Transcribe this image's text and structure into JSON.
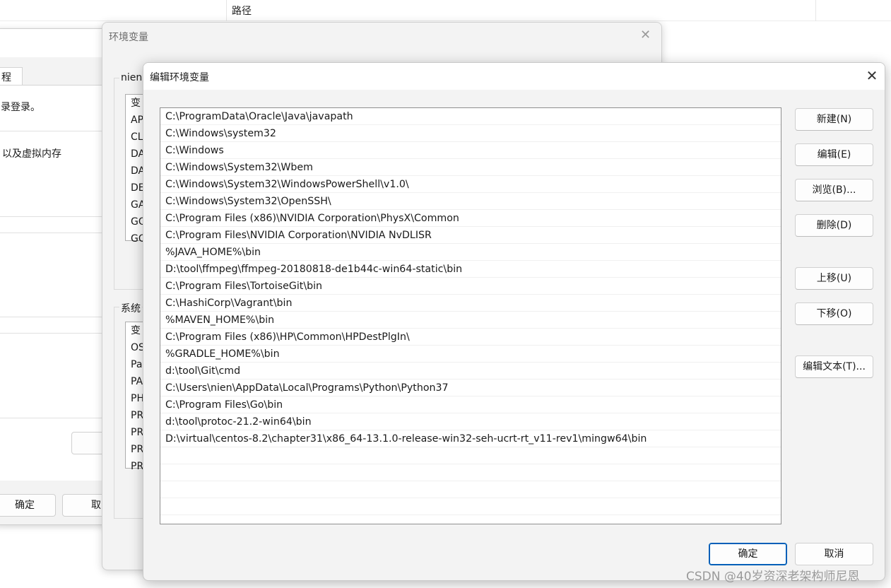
{
  "explorer": {
    "path_column": "路径"
  },
  "system_properties": {
    "tab_label": "程",
    "text_login": "录登录。",
    "text_memory": "以及虚拟内存",
    "ok_label": "确定",
    "cancel_label": "取"
  },
  "env_window": {
    "title": "环境变量",
    "close": "✕",
    "user_group_label": "nien",
    "user_vars": [
      "变",
      "AP",
      "CL",
      "DA",
      "DA",
      "DE",
      "GA",
      "GO",
      "GO"
    ],
    "system_group_label": "系统",
    "system_vars": [
      "变",
      "OS",
      "Pa",
      "PA",
      "PH",
      "PR",
      "PR",
      "PR",
      "PR"
    ]
  },
  "edit_dialog": {
    "title": "编辑环境变量",
    "close": "✕",
    "paths": [
      "C:\\ProgramData\\Oracle\\Java\\javapath",
      "C:\\Windows\\system32",
      "C:\\Windows",
      "C:\\Windows\\System32\\Wbem",
      "C:\\Windows\\System32\\WindowsPowerShell\\v1.0\\",
      "C:\\Windows\\System32\\OpenSSH\\",
      "C:\\Program Files (x86)\\NVIDIA Corporation\\PhysX\\Common",
      "C:\\Program Files\\NVIDIA Corporation\\NVIDIA NvDLISR",
      "%JAVA_HOME%\\bin",
      "D:\\tool\\ffmpeg\\ffmpeg-20180818-de1b44c-win64-static\\bin",
      "C:\\Program Files\\TortoiseGit\\bin",
      "C:\\HashiCorp\\Vagrant\\bin",
      "%MAVEN_HOME%\\bin",
      "C:\\Program Files (x86)\\HP\\Common\\HPDestPlgIn\\",
      "%GRADLE_HOME%\\bin",
      "d:\\tool\\Git\\cmd",
      "C:\\Users\\nien\\AppData\\Local\\Programs\\Python\\Python37",
      "C:\\Program Files\\Go\\bin",
      "d:\\tool\\protoc-21.2-win64\\bin",
      "D:\\virtual\\centos-8.2\\chapter31\\x86_64-13.1.0-release-win32-seh-ucrt-rt_v11-rev1\\mingw64\\bin"
    ],
    "buttons": {
      "new": "新建(N)",
      "edit": "编辑(E)",
      "browse": "浏览(B)...",
      "delete": "删除(D)",
      "move_up": "上移(U)",
      "move_down": "下移(O)",
      "edit_text": "编辑文本(T)...",
      "ok": "确定",
      "cancel": "取消"
    }
  },
  "watermark": "CSDN @40岁资深老架构师尼恩"
}
